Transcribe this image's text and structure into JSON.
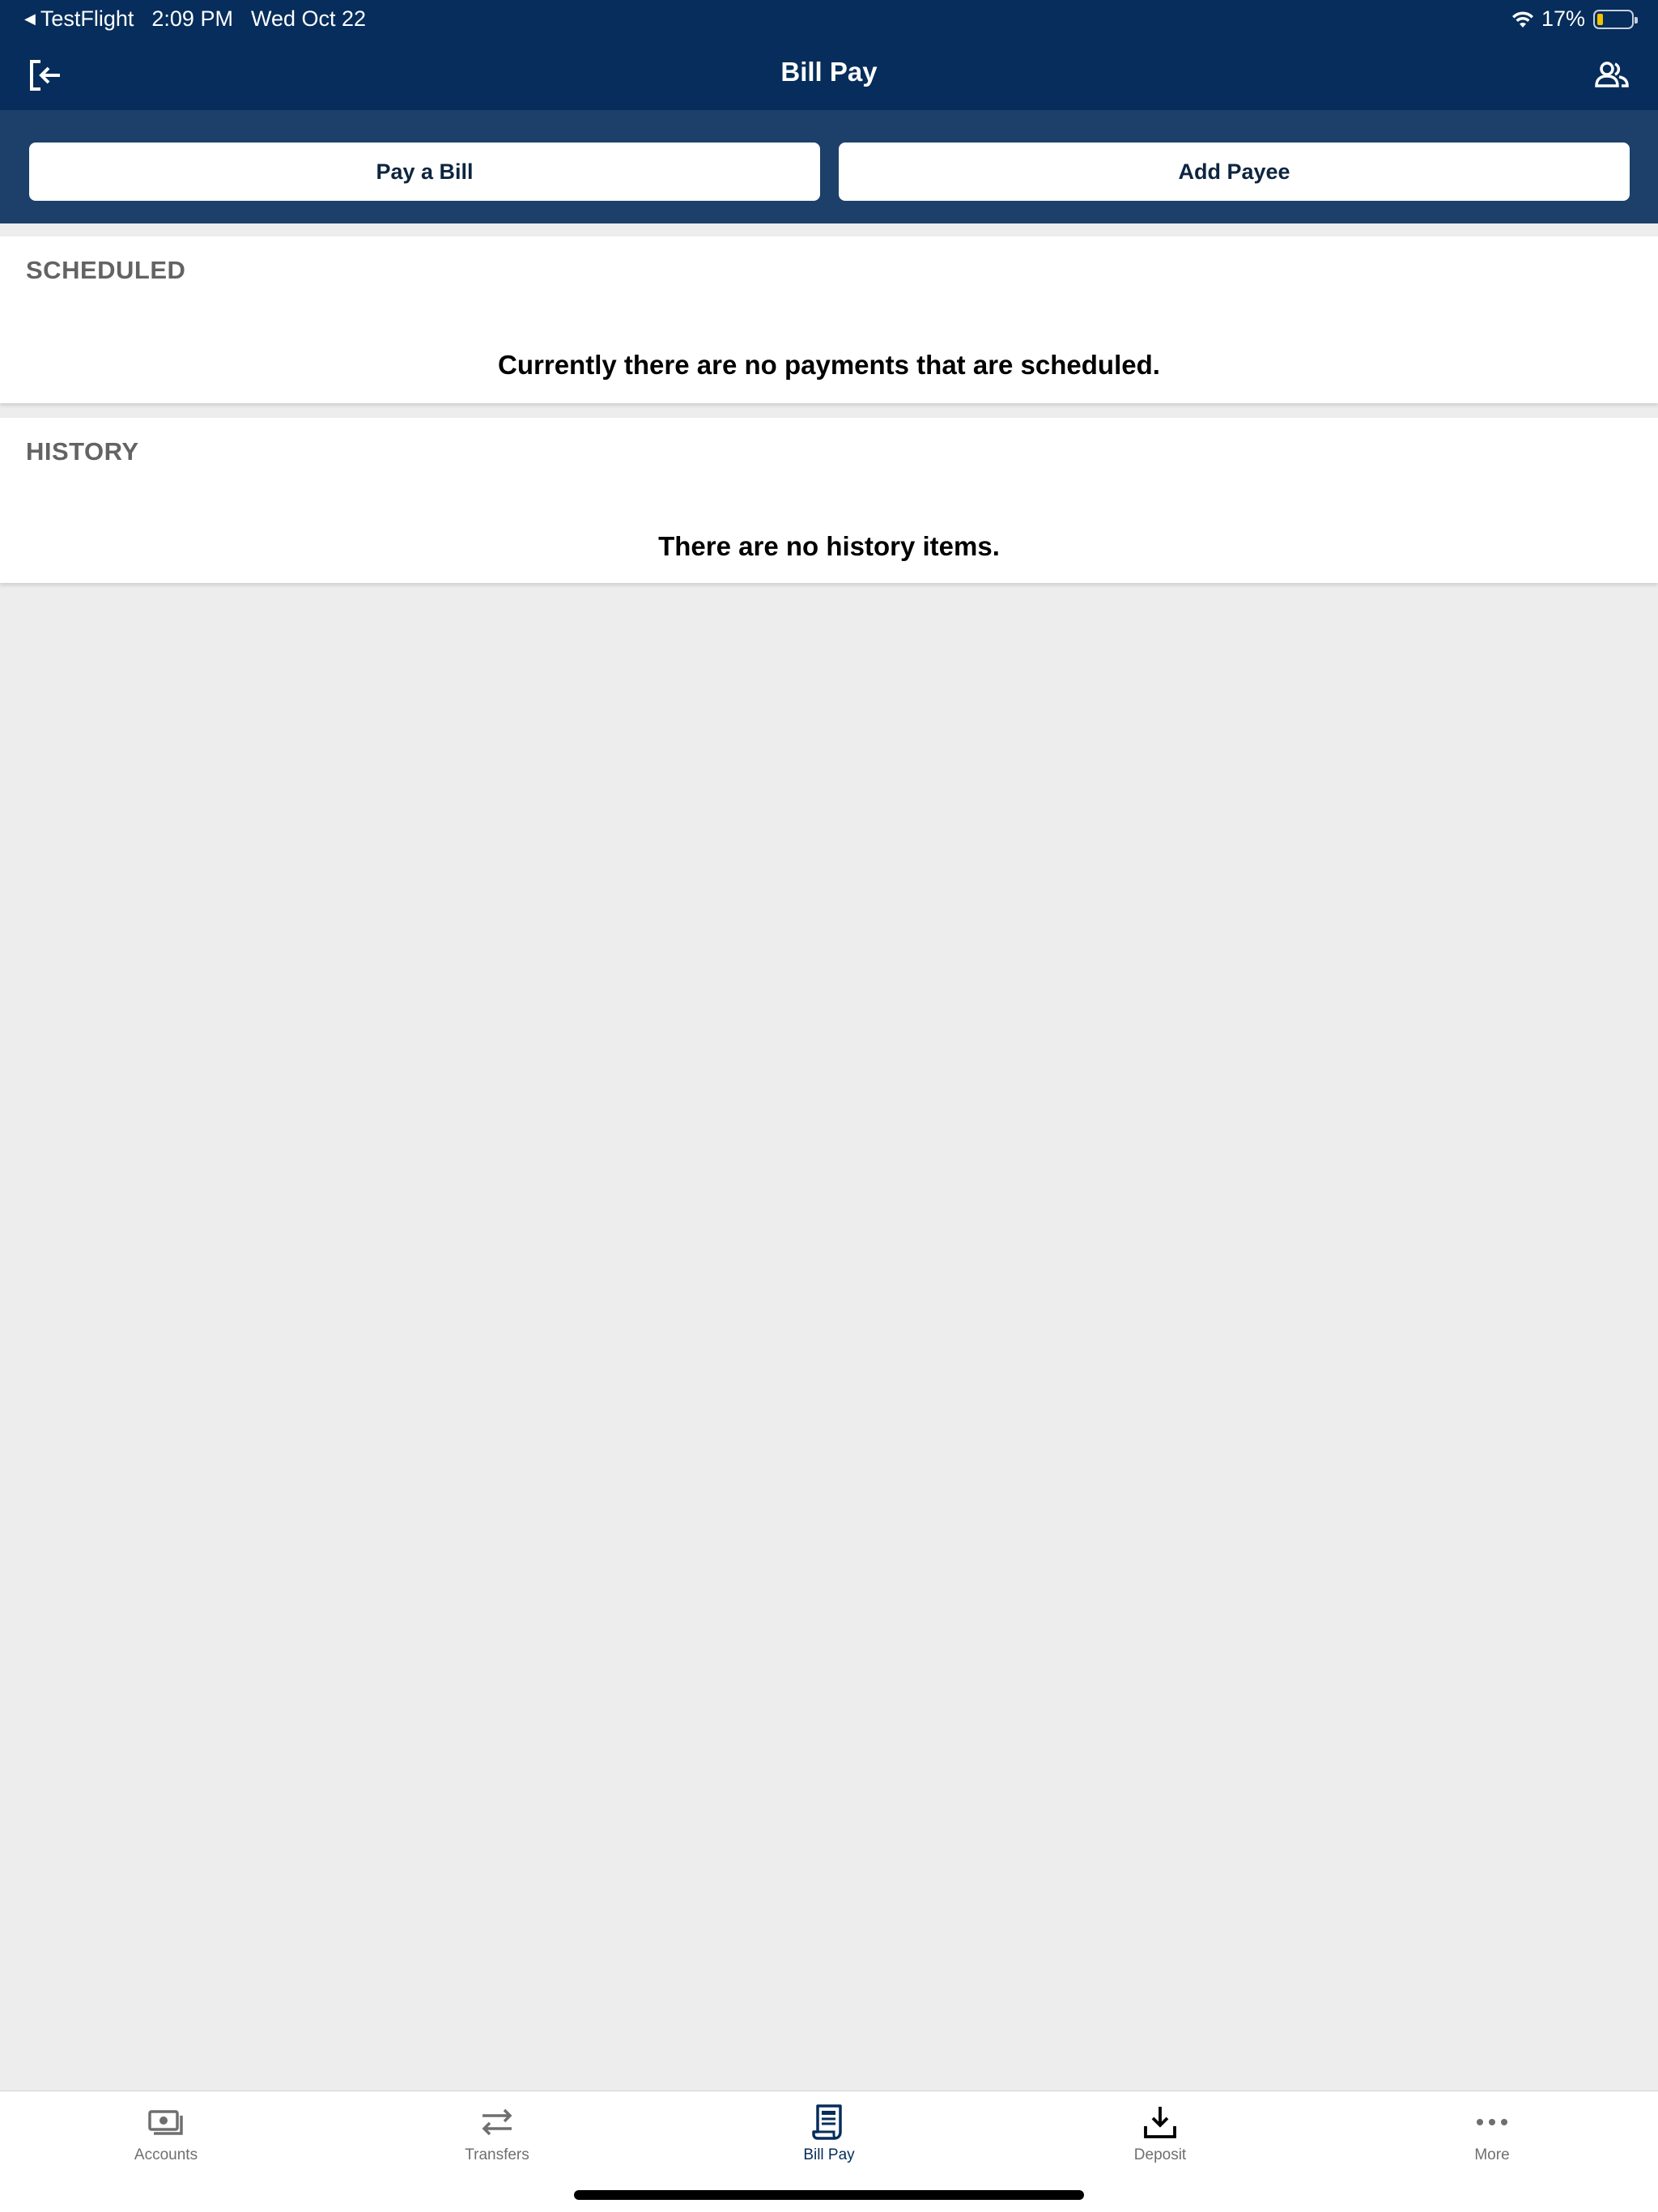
{
  "status_bar": {
    "back_app": "TestFlight",
    "time": "2:09 PM",
    "date": "Wed Oct 22",
    "battery": "17%",
    "battery_level": 0.17
  },
  "nav": {
    "title": "Bill Pay",
    "left_icon": "logout-icon",
    "right_icon": "people-icon"
  },
  "actions": {
    "pay_bill": "Pay a Bill",
    "add_payee": "Add Payee"
  },
  "scheduled": {
    "header": "SCHEDULED",
    "empty_message": "Currently there are no payments that are scheduled."
  },
  "history": {
    "header": "HISTORY",
    "empty_message": "There are no history items."
  },
  "tabs": [
    {
      "label": "Accounts",
      "icon": "cash-icon",
      "active": false
    },
    {
      "label": "Transfers",
      "icon": "transfer-arrows-icon",
      "active": false
    },
    {
      "label": "Bill Pay",
      "icon": "bill-icon",
      "active": true
    },
    {
      "label": "Deposit",
      "icon": "download-tray-icon",
      "active": false
    },
    {
      "label": "More",
      "icon": "more-dots-icon",
      "active": false
    }
  ],
  "colors": {
    "nav_background": "#062d5b",
    "action_band": "#1c4069",
    "page_background": "#ededed",
    "tab_active": "#062d5b",
    "tab_inactive": "#6f6f6f"
  }
}
